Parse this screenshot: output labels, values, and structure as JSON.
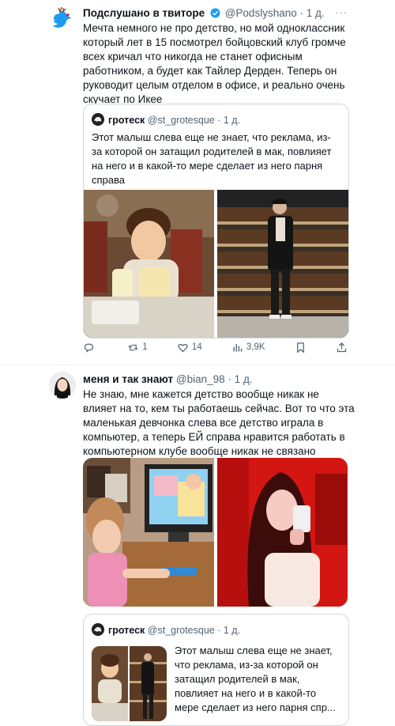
{
  "tweet1": {
    "author": "Подслушано в твиторе",
    "handle": "@Podslyshano",
    "time": "· 1 д.",
    "more": "···",
    "text": "Мечта немного не про детство, но мой одноклассник который лет в 15 посмотрел бойцовский клуб громче всех кричал что никогда не станет офисным работником, а будет как Тайлер Дерден. Теперь он руководит целым отделом в офисе, и реально очень скучает по Икее",
    "quote": {
      "author": "гротеск",
      "handle": "@st_grotesque",
      "time": "· 1 д.",
      "text": "Этот малыш слева  еще не знает, что реклама, из-за которой он затащил родителей в мак, повлияет на него и в какой-то мере сделает из него парня справа"
    },
    "actions": {
      "reply": "",
      "retweets": "1",
      "likes": "14",
      "views": "3,9K"
    }
  },
  "tweet2": {
    "author": "меня и так знают",
    "handle": "@bian_98",
    "time": "· 1 д.",
    "text": "Не знаю, мне кажется детство вообще никак не влияет на то, кем ты работаешь сейчас. Вот то что эта маленькая девчонка слева все детство играла в компьютер, а теперь ЕЙ справа нравится работать в компьютерном клубе вообще никак не связано",
    "quote": {
      "author": "гротеск",
      "handle": "@st_grotesque",
      "time": "· 1 д.",
      "text": "Этот малыш слева  еще не знает, что реклама, из-за которой он затащил родителей в мак, повлияет на него и в какой-то мере сделает из него парня спр..."
    }
  },
  "colors": {
    "accent": "#1d9bf0",
    "text": "#0f1419",
    "secondary": "#536471",
    "border": "#cfd9de"
  }
}
